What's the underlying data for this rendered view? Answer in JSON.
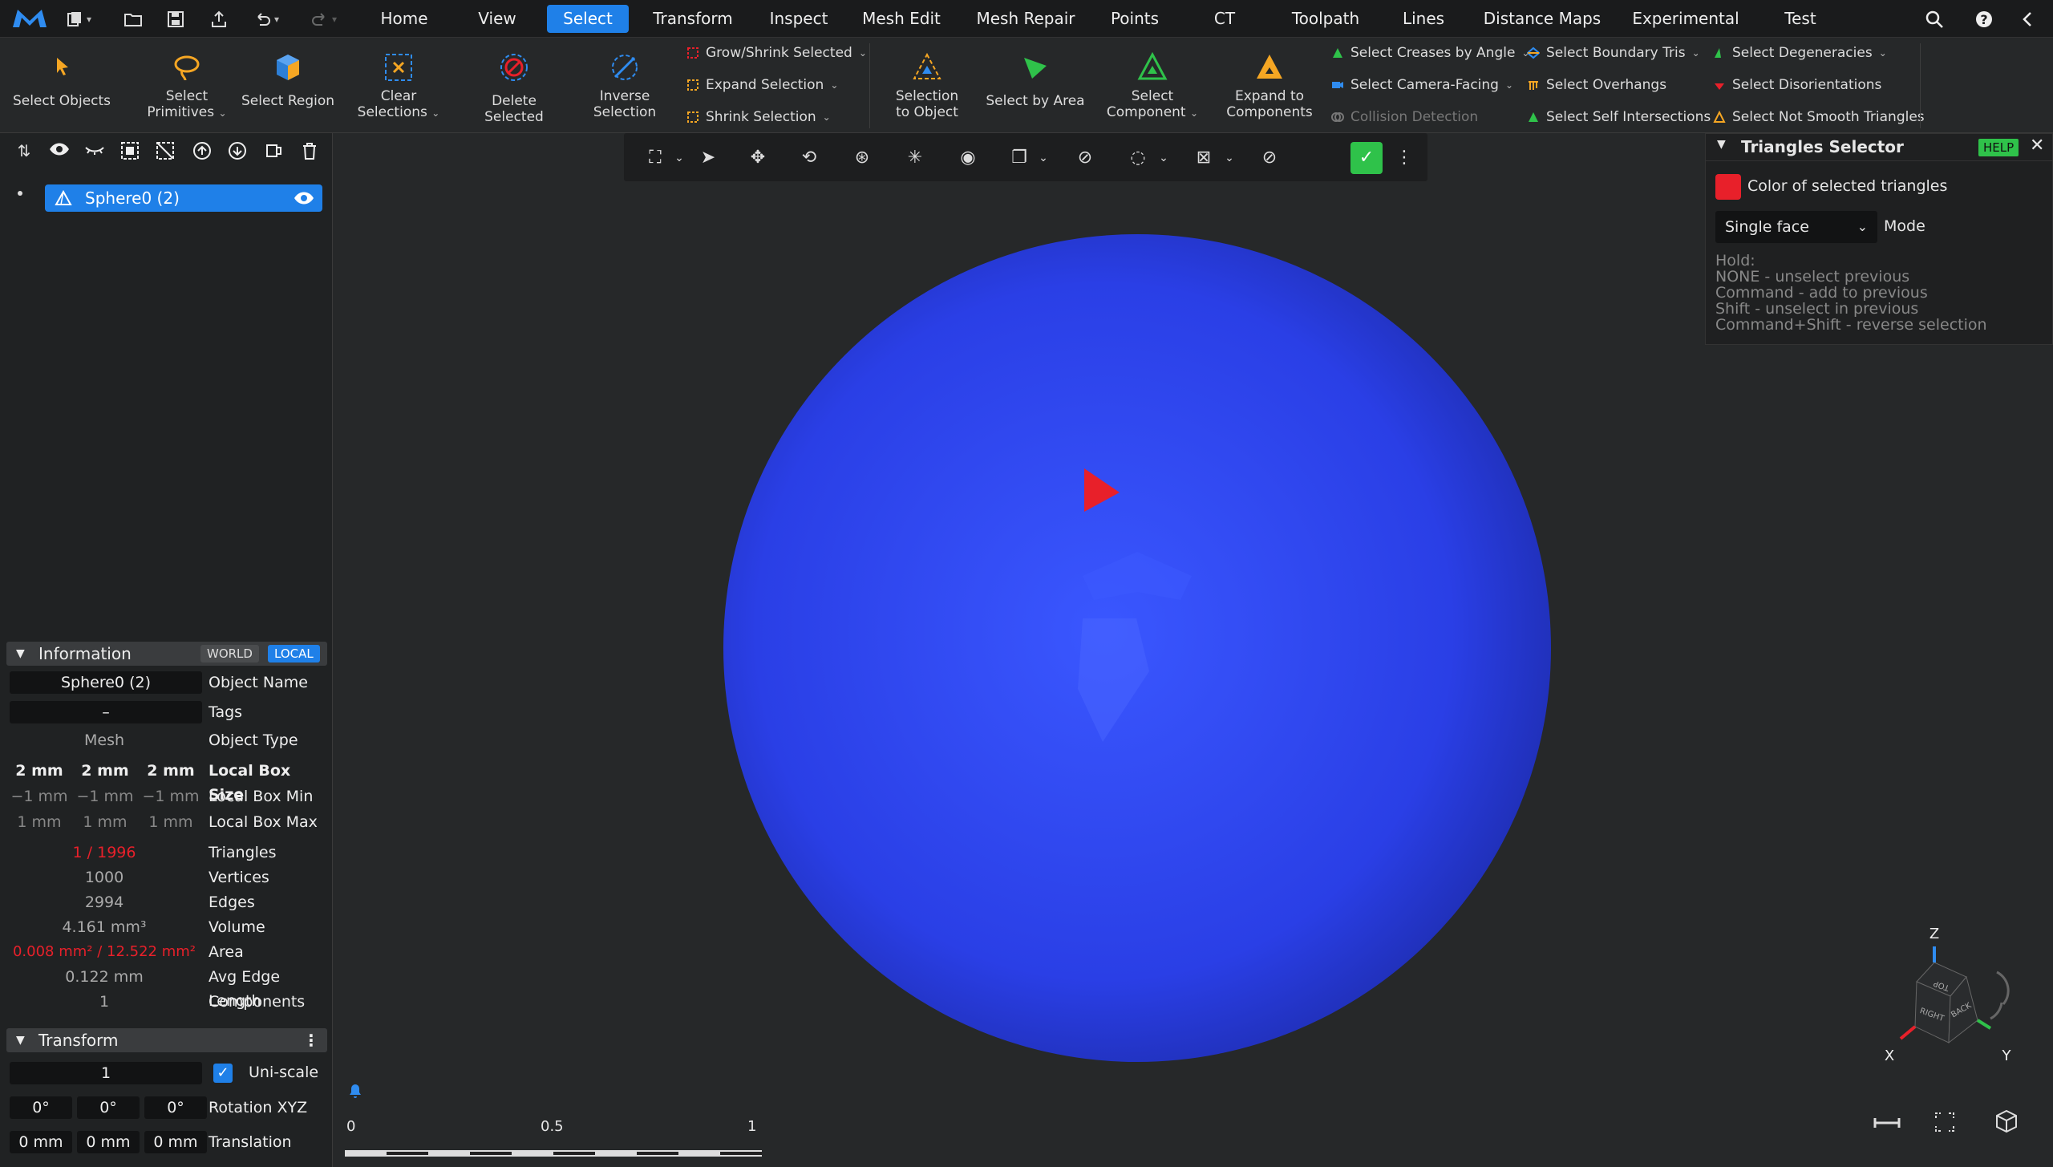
{
  "menu": {
    "tabs": [
      "Home",
      "View",
      "Select",
      "Transform",
      "Inspect",
      "Mesh Edit",
      "Mesh Repair",
      "Points",
      "CT",
      "Toolpath",
      "Lines",
      "Distance Maps",
      "Experimental",
      "Test"
    ],
    "active": "Select"
  },
  "ribbon": {
    "select_objects": "Select Objects",
    "select_primitives_1": "Select",
    "select_primitives_2": "Primitives",
    "select_region": "Select Region",
    "clear_selections_1": "Clear",
    "clear_selections_2": "Selections",
    "delete_selected": "Delete Selected",
    "inverse_selection_1": "Inverse",
    "inverse_selection_2": "Selection",
    "grow_shrink": "Grow/Shrink Selected",
    "expand_selection": "Expand Selection",
    "shrink_selection": "Shrink Selection",
    "selection_to_object_1": "Selection",
    "selection_to_object_2": "to Object",
    "select_by_area": "Select by Area",
    "select_component_1": "Select",
    "select_component_2": "Component",
    "expand_components_1": "Expand to",
    "expand_components_2": "Components",
    "creases": "Select Creases by Angle",
    "camera_facing": "Select Camera-Facing",
    "collision": "Collision Detection",
    "boundary_tris": "Select Boundary Tris",
    "overhangs": "Select Overhangs",
    "self_intersections": "Select Self Intersections",
    "degeneracies": "Select Degeneracies",
    "disorientations": "Select Disorientations",
    "not_smooth": "Select Not Smooth Triangles"
  },
  "scene": {
    "object": "Sphere0 (2)"
  },
  "info": {
    "title": "Information",
    "world": "WORLD",
    "local": "LOCAL",
    "object_name_val": "Sphere0 (2)",
    "object_name": "Object Name",
    "tags_val": "–",
    "tags": "Tags",
    "type_val": "Mesh",
    "type": "Object Type",
    "box_size": [
      "2 mm",
      "2 mm",
      "2 mm"
    ],
    "box_size_lbl": "Local Box Size",
    "box_min": [
      "−1 mm",
      "−1 mm",
      "−1 mm"
    ],
    "box_min_lbl": "Local Box Min",
    "box_max": [
      "1 mm",
      "1 mm",
      "1 mm"
    ],
    "box_max_lbl": "Local Box Max",
    "triangles_val": "1 / 1996",
    "triangles": "Triangles",
    "vertices_val": "1000",
    "vertices": "Vertices",
    "edges_val": "2994",
    "edges": "Edges",
    "volume_val": "4.161 mm³",
    "volume": "Volume",
    "area_val": "0.008 mm² / 12.522 mm²",
    "area": "Area",
    "avg_edge_val": "0.122 mm",
    "avg_edge": "Avg Edge Length",
    "components_val": "1",
    "components": "Components"
  },
  "transform": {
    "title": "Transform",
    "scale_val": "1",
    "uniscale": "Uni-scale",
    "rotation": [
      "0°",
      "0°",
      "0°"
    ],
    "rotation_lbl": "Rotation XYZ",
    "translation": [
      "0 mm",
      "0 mm",
      "0 mm"
    ],
    "translation_lbl": "Translation"
  },
  "tri_panel": {
    "title": "Triangles Selector",
    "help": "HELP",
    "color_label": "Color of selected triangles",
    "color": "#e8202a",
    "mode_value": "Single face",
    "mode_label": "Mode",
    "hold": "Hold:",
    "h1": "NONE - unselect previous",
    "h2": "Command - add to previous",
    "h3": "Shift - unselect in previous",
    "h4": "Command+Shift - reverse selection"
  },
  "scale_bar": {
    "t0": "0",
    "t1": "0.5",
    "t2": "1"
  },
  "axes": {
    "z": "Z",
    "x": "X",
    "y": "Y",
    "top": "TOP",
    "right": "RIGHT",
    "back": "BACK"
  },
  "colors": {
    "accent": "#1f80e8",
    "sphere": "#2a3fe6",
    "selected": "#e8202a"
  }
}
